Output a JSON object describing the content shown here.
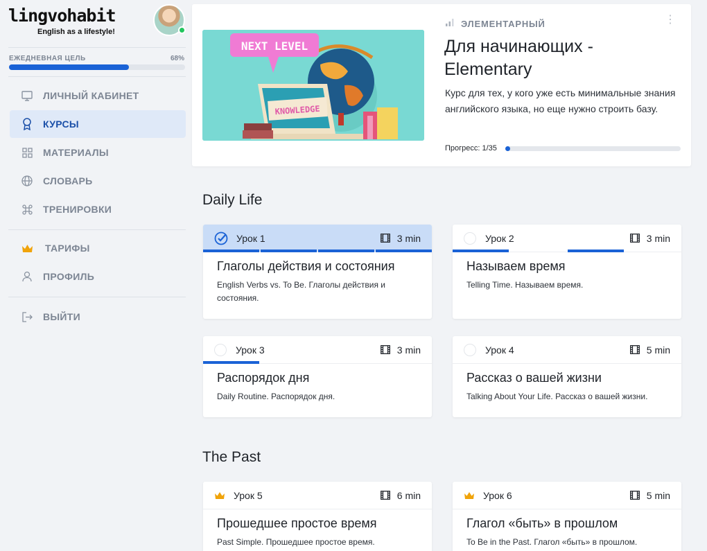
{
  "brand": {
    "name": "lingvohabit",
    "tagline": "English as a lifestyle!"
  },
  "daily_goal": {
    "label": "ЕЖЕДНЕВНАЯ ЦЕЛЬ",
    "percent_text": "68%",
    "fraction": 0.68
  },
  "nav": {
    "dashboard": "ЛИЧНЫЙ КАБИНЕТ",
    "courses": "КУРСЫ",
    "materials": "МАТЕРИАЛЫ",
    "dictionary": "СЛОВАРЬ",
    "trainings": "ТРЕНИРОВКИ",
    "plans": "ТАРИФЫ",
    "profile": "ПРОФИЛЬ",
    "logout": "ВЫЙТИ"
  },
  "course": {
    "level": "ЭЛЕМЕНТАРНЫЙ",
    "title": "Для начинающих - Elementary",
    "description": "Курс для тех, у кого уже есть минимальные знания английского языка, но еще нужно строить базу.",
    "progress_label": "Прогресс: 1/35",
    "progress_fraction": 0.029,
    "image_text_top": "NEXT LEVEL",
    "image_text_screen": "KNOWLEDGE"
  },
  "sections": [
    {
      "title": "Daily Life",
      "lessons": [
        {
          "num": "Урок 1",
          "duration": "3 min",
          "title": "Глаголы действия и состояния",
          "subtitle": "English Verbs vs. To Be. Глаголы действия и состояния.",
          "status": "done",
          "segments": [
            1,
            1,
            1,
            1
          ]
        },
        {
          "num": "Урок 2",
          "duration": "3 min",
          "title": "Называем время",
          "subtitle": "Telling Time. Называем время.",
          "status": "open",
          "segments": [
            1,
            0,
            1,
            0
          ]
        },
        {
          "num": "Урок 3",
          "duration": "3 min",
          "title": "Распорядок дня",
          "subtitle": "Daily Routine. Распорядок дня.",
          "status": "open",
          "segments": [
            1,
            0,
            0,
            0
          ]
        },
        {
          "num": "Урок 4",
          "duration": "5 min",
          "title": "Рассказ о вашей жизни",
          "subtitle": "Talking About Your Life. Рассказ о вашей жизни.",
          "status": "open",
          "segments": [
            0,
            0,
            0,
            0
          ]
        }
      ]
    },
    {
      "title": "The Past",
      "lessons": [
        {
          "num": "Урок 5",
          "duration": "6 min",
          "title": "Прошедшее простое время",
          "subtitle": "Past Simple. Прошедшее простое время.",
          "status": "premium",
          "segments": [
            0,
            0,
            0,
            0
          ]
        },
        {
          "num": "Урок 6",
          "duration": "5 min",
          "title": "Глагол «быть» в прошлом",
          "subtitle": "To Be in the Past. Глагол «быть» в прошлом.",
          "status": "premium",
          "segments": [
            0,
            0,
            0,
            0
          ]
        }
      ]
    }
  ],
  "colors": {
    "accent": "#1a62d6",
    "active_bg": "#dfe9f8",
    "done_header": "#c9dcf7",
    "crown": "#f0a30a",
    "online": "#22c55e"
  }
}
